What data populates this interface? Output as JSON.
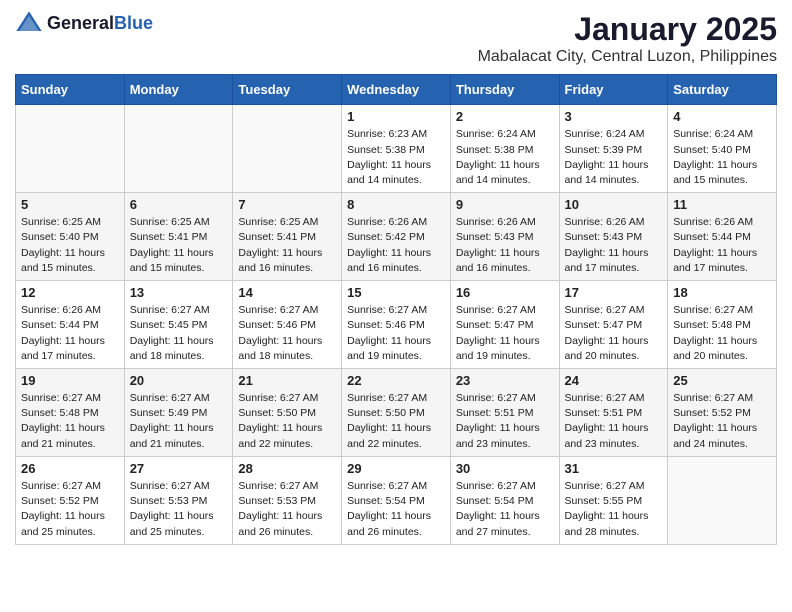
{
  "header": {
    "logo_general": "General",
    "logo_blue": "Blue",
    "month_title": "January 2025",
    "location": "Mabalacat City, Central Luzon, Philippines"
  },
  "days_of_week": [
    "Sunday",
    "Monday",
    "Tuesday",
    "Wednesday",
    "Thursday",
    "Friday",
    "Saturday"
  ],
  "weeks": [
    [
      {
        "num": "",
        "sunrise": "",
        "sunset": "",
        "daylight": ""
      },
      {
        "num": "",
        "sunrise": "",
        "sunset": "",
        "daylight": ""
      },
      {
        "num": "",
        "sunrise": "",
        "sunset": "",
        "daylight": ""
      },
      {
        "num": "1",
        "sunrise": "Sunrise: 6:23 AM",
        "sunset": "Sunset: 5:38 PM",
        "daylight": "Daylight: 11 hours and 14 minutes."
      },
      {
        "num": "2",
        "sunrise": "Sunrise: 6:24 AM",
        "sunset": "Sunset: 5:38 PM",
        "daylight": "Daylight: 11 hours and 14 minutes."
      },
      {
        "num": "3",
        "sunrise": "Sunrise: 6:24 AM",
        "sunset": "Sunset: 5:39 PM",
        "daylight": "Daylight: 11 hours and 14 minutes."
      },
      {
        "num": "4",
        "sunrise": "Sunrise: 6:24 AM",
        "sunset": "Sunset: 5:40 PM",
        "daylight": "Daylight: 11 hours and 15 minutes."
      }
    ],
    [
      {
        "num": "5",
        "sunrise": "Sunrise: 6:25 AM",
        "sunset": "Sunset: 5:40 PM",
        "daylight": "Daylight: 11 hours and 15 minutes."
      },
      {
        "num": "6",
        "sunrise": "Sunrise: 6:25 AM",
        "sunset": "Sunset: 5:41 PM",
        "daylight": "Daylight: 11 hours and 15 minutes."
      },
      {
        "num": "7",
        "sunrise": "Sunrise: 6:25 AM",
        "sunset": "Sunset: 5:41 PM",
        "daylight": "Daylight: 11 hours and 16 minutes."
      },
      {
        "num": "8",
        "sunrise": "Sunrise: 6:26 AM",
        "sunset": "Sunset: 5:42 PM",
        "daylight": "Daylight: 11 hours and 16 minutes."
      },
      {
        "num": "9",
        "sunrise": "Sunrise: 6:26 AM",
        "sunset": "Sunset: 5:43 PM",
        "daylight": "Daylight: 11 hours and 16 minutes."
      },
      {
        "num": "10",
        "sunrise": "Sunrise: 6:26 AM",
        "sunset": "Sunset: 5:43 PM",
        "daylight": "Daylight: 11 hours and 17 minutes."
      },
      {
        "num": "11",
        "sunrise": "Sunrise: 6:26 AM",
        "sunset": "Sunset: 5:44 PM",
        "daylight": "Daylight: 11 hours and 17 minutes."
      }
    ],
    [
      {
        "num": "12",
        "sunrise": "Sunrise: 6:26 AM",
        "sunset": "Sunset: 5:44 PM",
        "daylight": "Daylight: 11 hours and 17 minutes."
      },
      {
        "num": "13",
        "sunrise": "Sunrise: 6:27 AM",
        "sunset": "Sunset: 5:45 PM",
        "daylight": "Daylight: 11 hours and 18 minutes."
      },
      {
        "num": "14",
        "sunrise": "Sunrise: 6:27 AM",
        "sunset": "Sunset: 5:46 PM",
        "daylight": "Daylight: 11 hours and 18 minutes."
      },
      {
        "num": "15",
        "sunrise": "Sunrise: 6:27 AM",
        "sunset": "Sunset: 5:46 PM",
        "daylight": "Daylight: 11 hours and 19 minutes."
      },
      {
        "num": "16",
        "sunrise": "Sunrise: 6:27 AM",
        "sunset": "Sunset: 5:47 PM",
        "daylight": "Daylight: 11 hours and 19 minutes."
      },
      {
        "num": "17",
        "sunrise": "Sunrise: 6:27 AM",
        "sunset": "Sunset: 5:47 PM",
        "daylight": "Daylight: 11 hours and 20 minutes."
      },
      {
        "num": "18",
        "sunrise": "Sunrise: 6:27 AM",
        "sunset": "Sunset: 5:48 PM",
        "daylight": "Daylight: 11 hours and 20 minutes."
      }
    ],
    [
      {
        "num": "19",
        "sunrise": "Sunrise: 6:27 AM",
        "sunset": "Sunset: 5:48 PM",
        "daylight": "Daylight: 11 hours and 21 minutes."
      },
      {
        "num": "20",
        "sunrise": "Sunrise: 6:27 AM",
        "sunset": "Sunset: 5:49 PM",
        "daylight": "Daylight: 11 hours and 21 minutes."
      },
      {
        "num": "21",
        "sunrise": "Sunrise: 6:27 AM",
        "sunset": "Sunset: 5:50 PM",
        "daylight": "Daylight: 11 hours and 22 minutes."
      },
      {
        "num": "22",
        "sunrise": "Sunrise: 6:27 AM",
        "sunset": "Sunset: 5:50 PM",
        "daylight": "Daylight: 11 hours and 22 minutes."
      },
      {
        "num": "23",
        "sunrise": "Sunrise: 6:27 AM",
        "sunset": "Sunset: 5:51 PM",
        "daylight": "Daylight: 11 hours and 23 minutes."
      },
      {
        "num": "24",
        "sunrise": "Sunrise: 6:27 AM",
        "sunset": "Sunset: 5:51 PM",
        "daylight": "Daylight: 11 hours and 23 minutes."
      },
      {
        "num": "25",
        "sunrise": "Sunrise: 6:27 AM",
        "sunset": "Sunset: 5:52 PM",
        "daylight": "Daylight: 11 hours and 24 minutes."
      }
    ],
    [
      {
        "num": "26",
        "sunrise": "Sunrise: 6:27 AM",
        "sunset": "Sunset: 5:52 PM",
        "daylight": "Daylight: 11 hours and 25 minutes."
      },
      {
        "num": "27",
        "sunrise": "Sunrise: 6:27 AM",
        "sunset": "Sunset: 5:53 PM",
        "daylight": "Daylight: 11 hours and 25 minutes."
      },
      {
        "num": "28",
        "sunrise": "Sunrise: 6:27 AM",
        "sunset": "Sunset: 5:53 PM",
        "daylight": "Daylight: 11 hours and 26 minutes."
      },
      {
        "num": "29",
        "sunrise": "Sunrise: 6:27 AM",
        "sunset": "Sunset: 5:54 PM",
        "daylight": "Daylight: 11 hours and 26 minutes."
      },
      {
        "num": "30",
        "sunrise": "Sunrise: 6:27 AM",
        "sunset": "Sunset: 5:54 PM",
        "daylight": "Daylight: 11 hours and 27 minutes."
      },
      {
        "num": "31",
        "sunrise": "Sunrise: 6:27 AM",
        "sunset": "Sunset: 5:55 PM",
        "daylight": "Daylight: 11 hours and 28 minutes."
      },
      {
        "num": "",
        "sunrise": "",
        "sunset": "",
        "daylight": ""
      }
    ]
  ]
}
